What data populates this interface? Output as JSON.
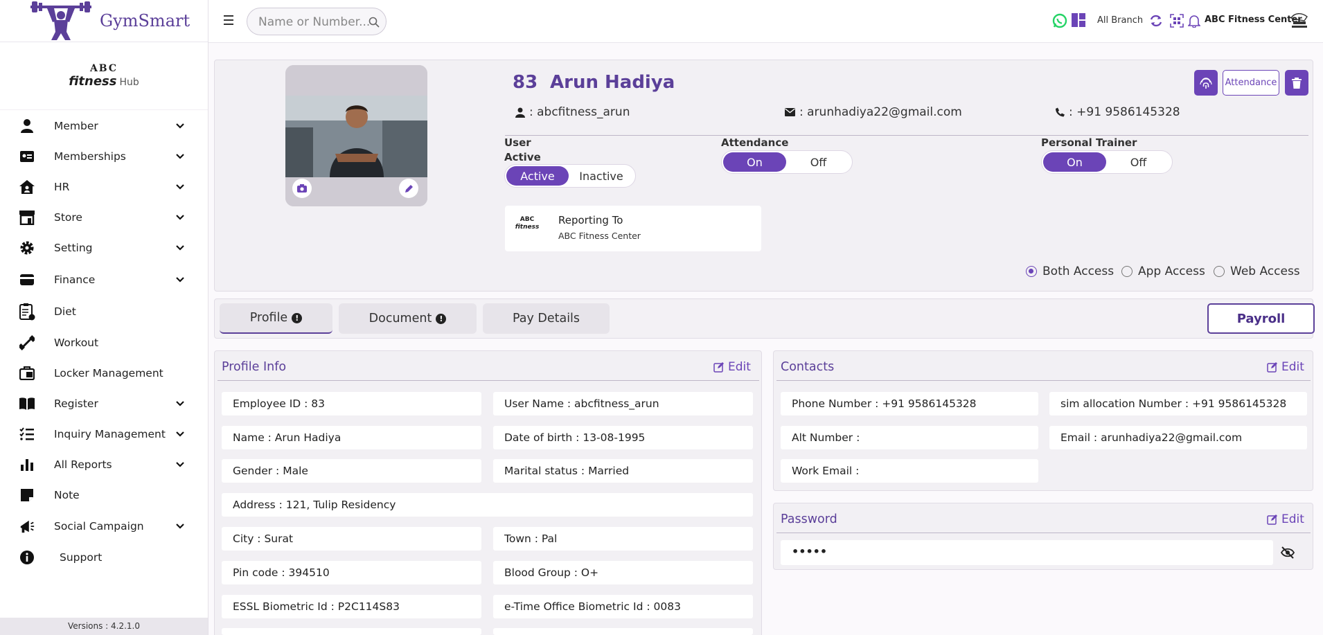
{
  "app": {
    "name": "GymSmart",
    "version": "Versions : 4.2.1.0"
  },
  "org_logo": {
    "line1": "ABC",
    "line2": "fitness",
    "line3": "Hub"
  },
  "sidebar": {
    "items": [
      {
        "label": "Member",
        "icon": "user-icon",
        "chevron": true
      },
      {
        "label": "Memberships",
        "icon": "id-card-icon",
        "chevron": true
      },
      {
        "label": "HR",
        "icon": "hr-home-icon",
        "chevron": true
      },
      {
        "label": "Store",
        "icon": "store-icon",
        "chevron": true
      },
      {
        "label": "Setting",
        "icon": "gear-icon",
        "chevron": true
      },
      {
        "label": "Finance",
        "icon": "wallet-icon",
        "chevron": true
      },
      {
        "label": "Diet",
        "icon": "diet-clipboard-icon",
        "chevron": false
      },
      {
        "label": "Workout",
        "icon": "dumbbell-icon",
        "chevron": false
      },
      {
        "label": "Locker Management",
        "icon": "locker-icon",
        "chevron": false
      },
      {
        "label": "Register",
        "icon": "book-icon",
        "chevron": true
      },
      {
        "label": "Inquiry Management",
        "icon": "list-icon",
        "chevron": true
      },
      {
        "label": "All Reports",
        "icon": "bar-chart-icon",
        "chevron": true
      },
      {
        "label": "Note",
        "icon": "note-icon",
        "chevron": false
      },
      {
        "label": "Social Campaign",
        "icon": "megaphone-icon",
        "chevron": true
      },
      {
        "label": "Support",
        "icon": "info-icon",
        "chevron": false
      }
    ]
  },
  "topbar": {
    "search_placeholder": "Name or Number...",
    "branch": "All Branch",
    "center": "ABC Fitness Center"
  },
  "employee": {
    "number": "83",
    "name": "Arun Hadiya",
    "username": ": abcfitness_arun",
    "email": ": arunhadiya22@gmail.com",
    "phone": ": +91 9586145328"
  },
  "header_buttons": {
    "attendance": "Attendance"
  },
  "status": {
    "user_label_1": "User",
    "user_label_2": "Active",
    "user_active": "Active",
    "user_inactive": "Inactive",
    "attendance_label": "Attendance",
    "attendance_on": "On",
    "attendance_off": "Off",
    "trainer_label": "Personal Trainer",
    "trainer_on": "On",
    "trainer_off": "Off"
  },
  "reporting": {
    "title": "Reporting To",
    "value": "ABC Fitness Center"
  },
  "access": {
    "both": "Both Access",
    "app": "App Access",
    "web": "Web Access",
    "selected": "both"
  },
  "tabs": {
    "profile": "Profile",
    "document": "Document",
    "pay": "Pay Details",
    "payroll": "Payroll"
  },
  "profile_info": {
    "title": "Profile Info",
    "edit": "Edit",
    "fields": {
      "employee_id": "Employee ID : 83",
      "user_name": "User Name : abcfitness_arun",
      "name": "Name : Arun Hadiya",
      "dob": "Date of birth : 13-08-1995",
      "gender": "Gender : Male",
      "marital": "Marital status : Married",
      "address": "Address : 121, Tulip Residency",
      "city": "City : Surat",
      "town": "Town : Pal",
      "pin": "Pin code : 394510",
      "blood": "Blood Group : O+",
      "essl": "ESSL Biometric Id : P2C114S83",
      "etime": "e-Time Office Biometric Id : 0083"
    }
  },
  "contacts": {
    "title": "Contacts",
    "edit": "Edit",
    "phone": "Phone Number : +91 9586145328",
    "sim": "sim allocation Number : +91 9586145328",
    "alt": "Alt Number :",
    "email": "Email : arunhadiya22@gmail.com",
    "work_email": "Work Email :"
  },
  "password": {
    "title": "Password",
    "edit": "Edit",
    "value": "•••••"
  },
  "colors": {
    "brand": "#5b3f99",
    "accent": "#6b44b7",
    "whatsapp": "#25d366"
  }
}
